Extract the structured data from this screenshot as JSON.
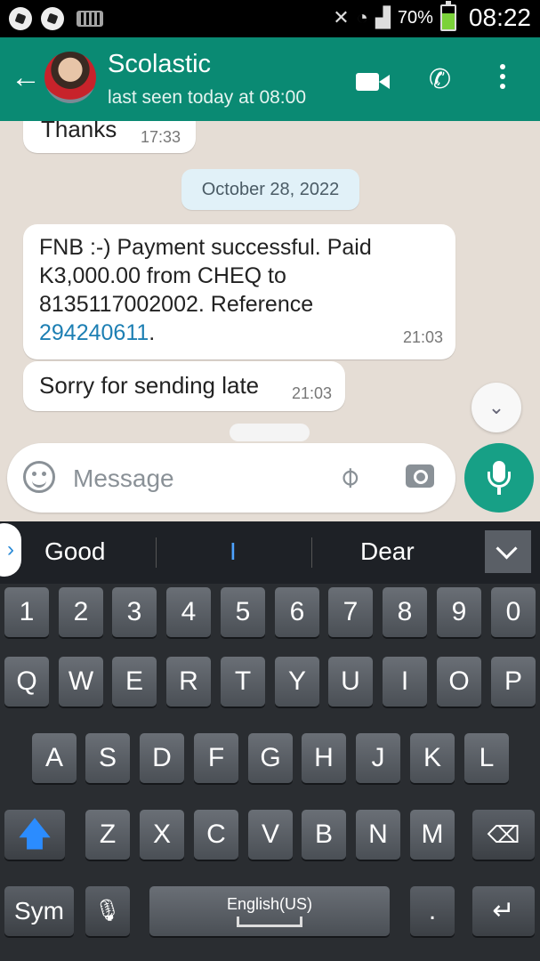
{
  "status_bar": {
    "battery": "70%",
    "time": "08:22"
  },
  "header": {
    "contact_name": "Scolastic",
    "last_seen": "last seen today at 08:00"
  },
  "messages": {
    "thanks": {
      "text": "Thanks",
      "time": "17:33"
    },
    "date_separator": "October 28, 2022",
    "fnb": {
      "text_before": "FNB :-) Payment successful. Paid K3,000.00 from CHEQ to 8135117002002. Reference ",
      "reference": "294240611",
      "text_after": ".",
      "time": "21:03"
    },
    "sorry": {
      "text": "Sorry for sending late",
      "time": "21:03"
    }
  },
  "composer": {
    "placeholder": "Message"
  },
  "suggestions": [
    "Good",
    "I",
    "Dear"
  ],
  "keyboard": {
    "number_row": [
      "1",
      "2",
      "3",
      "4",
      "5",
      "6",
      "7",
      "8",
      "9",
      "0"
    ],
    "row1": [
      "Q",
      "W",
      "E",
      "R",
      "T",
      "Y",
      "U",
      "I",
      "O",
      "P"
    ],
    "row2": [
      "A",
      "S",
      "D",
      "F",
      "G",
      "H",
      "J",
      "K",
      "L"
    ],
    "row3": [
      "Z",
      "X",
      "C",
      "V",
      "B",
      "N",
      "M"
    ],
    "sym": "Sym",
    "space_label": "English(US)",
    "period": "."
  }
}
